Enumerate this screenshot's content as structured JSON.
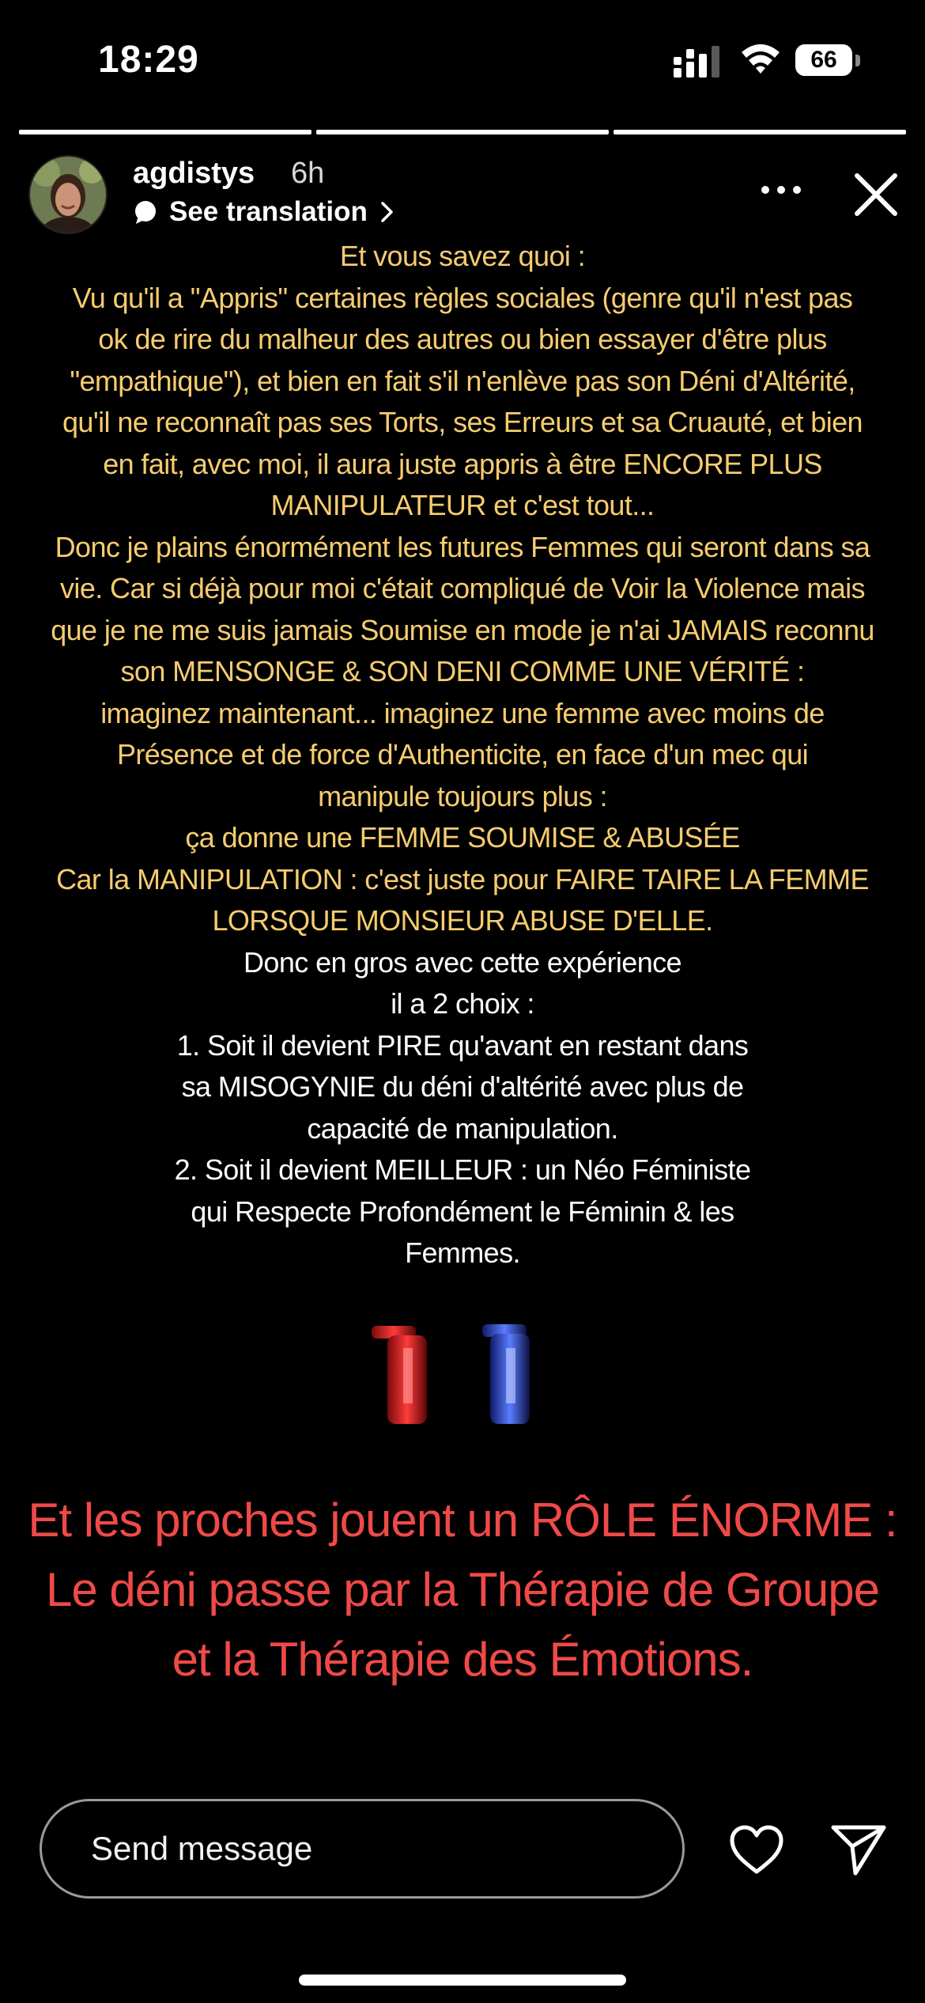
{
  "status_bar": {
    "time": "18:29",
    "battery": "66",
    "icons": [
      "cellular-signal-icon",
      "wifi-icon",
      "battery-icon"
    ]
  },
  "story_progress": {
    "total_segments": 3,
    "current_segment": 3
  },
  "header": {
    "username": "agdistys",
    "time_ago": "6h",
    "see_translation": "See translation",
    "icons": [
      "avatar",
      "translate-icon",
      "chevron-right-icon",
      "more-icon",
      "close-icon"
    ]
  },
  "story": {
    "lines": [
      {
        "text": "Et vous savez quoi :",
        "color": "#f6cc6f"
      },
      {
        "text": "Vu qu'il a \"Appris\" certaines règles sociales (genre qu'il n'est pas",
        "color": "#f6cc6f"
      },
      {
        "text": "ok de rire du malheur des autres ou bien essayer d'être plus",
        "color": "#f6cc6f"
      },
      {
        "text": "\"empathique\"), et bien en fait s'il n'enlève pas son Déni d'Altérité,",
        "color": "#f6cc6f"
      },
      {
        "text": "qu'il ne reconnaît pas ses Torts, ses Erreurs et sa Cruauté, et bien",
        "color": "#f6cc6f"
      },
      {
        "text": "en fait, avec moi, il aura juste appris à être ENCORE PLUS",
        "color": "#f6cc6f"
      },
      {
        "text": "MANIPULATEUR et c'est tout...",
        "color": "#f6cc6f"
      },
      {
        "text": "Donc je plains énormément les futures Femmes qui seront dans sa",
        "color": "#f6cc6f"
      },
      {
        "text": "vie. Car si déjà pour moi c'était compliqué de Voir la Violence mais",
        "color": "#f6cc6f"
      },
      {
        "text": "que je ne me suis jamais Soumise en mode je n'ai JAMAIS reconnu",
        "color": "#f6cc6f"
      },
      {
        "text": "son MENSONGE & SON DENI COMME UNE VÉRITÉ :",
        "color": "#f6cc6f"
      },
      {
        "text": "imaginez maintenant... imaginez une femme avec moins de",
        "color": "#f6cc6f"
      },
      {
        "text": "Présence et de force d'Authenticite, en face d'un mec qui",
        "color": "#f6cc6f"
      },
      {
        "text": "manipule toujours plus :",
        "color": "#f6cc6f"
      },
      {
        "text": "ça donne une FEMME SOUMISE & ABUSÉE",
        "color": "#f6cc6f"
      },
      {
        "text": "Car la MANIPULATION : c'est juste pour FAIRE TAIRE LA FEMME",
        "color": "#f6cc6f"
      },
      {
        "text": "LORSQUE MONSIEUR ABUSE D'ELLE.",
        "color": "#f6cc6f"
      },
      {
        "text": "Donc en gros avec cette expérience",
        "color": "#ffffff"
      },
      {
        "text": "il a 2 choix :",
        "color": "#ffffff"
      },
      {
        "text": "1. Soit il devient PIRE qu'avant en restant dans",
        "color": "#ffffff"
      },
      {
        "text": "sa MISOGYNIE du déni d'altérité avec plus de",
        "color": "#ffffff"
      },
      {
        "text": "capacité de manipulation.",
        "color": "#ffffff"
      },
      {
        "text": "2. Soit il devient MEILLEUR : un Néo Féministe",
        "color": "#ffffff"
      },
      {
        "text": "qui Respecte Profondément le Féminin & les",
        "color": "#ffffff"
      },
      {
        "text": "Femmes.",
        "color": "#ffffff"
      }
    ],
    "emojis": [
      "red-pillar-icon",
      "blue-pillar-icon"
    ],
    "highlight_lines": [
      "Et les proches jouent un RÔLE ÉNORME :",
      "Le déni passe par la Thérapie de Groupe",
      "et la Thérapie des Émotions."
    ],
    "highlight_color": "#ef4a48"
  },
  "bottom_bar": {
    "message_placeholder": "Send message",
    "icons": [
      "heart-icon",
      "send-icon"
    ]
  }
}
